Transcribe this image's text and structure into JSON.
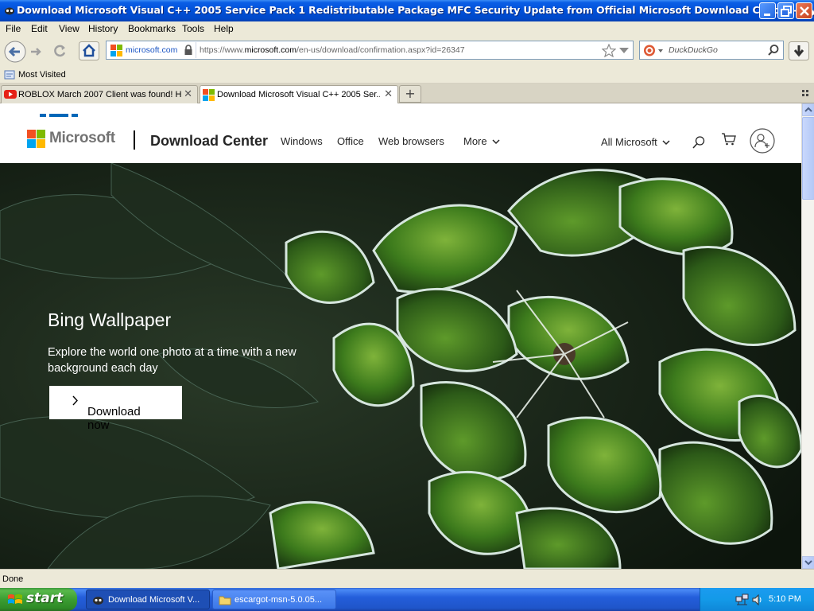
{
  "window": {
    "title": "Download Microsoft Visual C++ 2005 Service Pack 1 Redistributable Package MFC Security Update from Official Microsoft Download Center - Mypal"
  },
  "menu": [
    "File",
    "Edit",
    "View",
    "History",
    "Bookmarks",
    "Tools",
    "Help"
  ],
  "navigation": {
    "site_identity": "microsoft.com",
    "url_prefix": "https://www.",
    "url_domain": "microsoft.com",
    "url_path": "/en-us/download/confirmation.aspx?id=26347",
    "search_placeholder": "DuckDuckGo"
  },
  "bookmarks": {
    "most_visited": "Most Visited"
  },
  "tabs": [
    {
      "label": "ROBLOX March 2007 Client was found! H...",
      "active": false
    },
    {
      "label": "Download Microsoft Visual C++ 2005 Ser...",
      "active": true
    }
  ],
  "page": {
    "brand": "Microsoft",
    "site_title": "Download Center",
    "nav": [
      "Windows",
      "Office",
      "Web browsers",
      "More"
    ],
    "all_microsoft": "All Microsoft",
    "hero": {
      "title": "Bing Wallpaper",
      "description": "Explore the world one photo at a time with a new background each day",
      "button": "Download now"
    }
  },
  "status": {
    "text": "Done"
  },
  "taskbar": {
    "start": "start",
    "items": [
      {
        "label": "Download Microsoft V...",
        "active": true
      },
      {
        "label": "escargot-msn-5.0.05...",
        "active": false
      }
    ],
    "clock": "5:10 PM"
  },
  "colors": {
    "title_bar": "#0050d8",
    "ms_red": "#f25022",
    "ms_green": "#7fba00",
    "ms_blue": "#00a4ef",
    "ms_yellow": "#ffb900",
    "hero_bg": "#142015"
  }
}
